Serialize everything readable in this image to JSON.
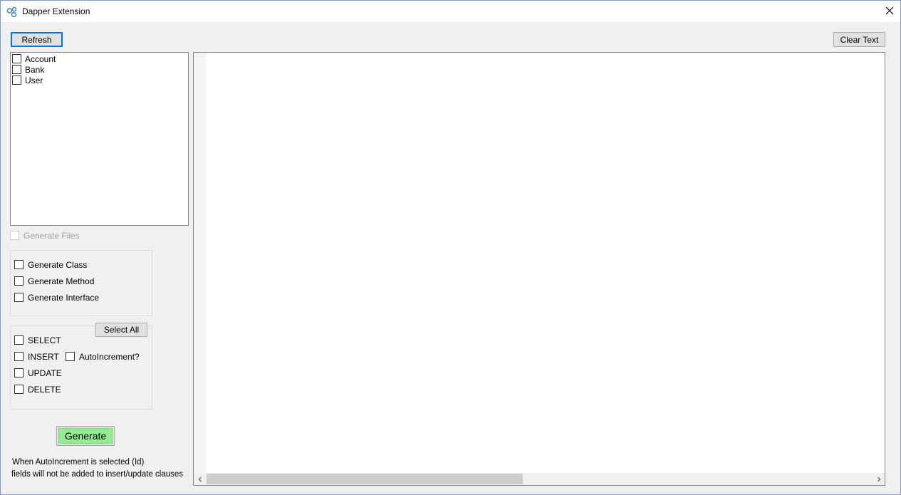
{
  "window": {
    "title": "Dapper Extension",
    "icon": "dapper-app-icon",
    "close_icon": "close-icon"
  },
  "toolbar": {
    "refresh_label": "Refresh",
    "clear_text_label": "Clear Text"
  },
  "tables": {
    "items": [
      {
        "label": "Account",
        "checked": false
      },
      {
        "label": "Bank",
        "checked": false
      },
      {
        "label": "User",
        "checked": false
      }
    ]
  },
  "generate_files": {
    "label": "Generate Files",
    "enabled": false
  },
  "code_options": {
    "items": [
      {
        "label": "Generate Class"
      },
      {
        "label": "Generate Method"
      },
      {
        "label": "Generate Interface"
      }
    ]
  },
  "sql_options": {
    "select_all_label": "Select All",
    "select_label": "SELECT",
    "insert_label": "INSERT",
    "autoincrement_label": "AutoIncrement?",
    "update_label": "UPDATE",
    "delete_label": "DELETE"
  },
  "generate": {
    "label": "Generate",
    "color": "#90ee90"
  },
  "note": {
    "line1": "When AutoIncrement is selected (Id)",
    "line2": "fields will not be added to insert/update clauses"
  },
  "editor": {
    "scroll_left_icon": "chevron-left-icon",
    "scroll_right_icon": "chevron-right-icon"
  },
  "colors": {
    "window_border": "#7a9cc6",
    "focus_border": "#0078d7",
    "generate_button": "#90ee90"
  }
}
